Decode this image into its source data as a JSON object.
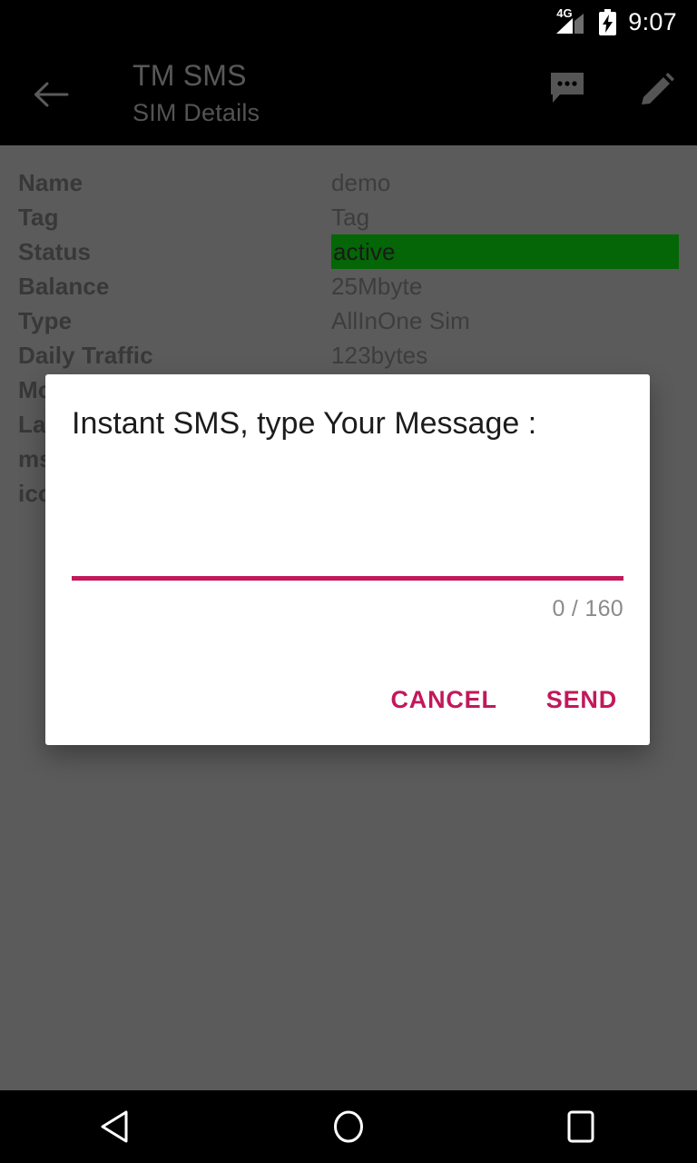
{
  "status_bar": {
    "network_label": "4G",
    "signal_icon": "signal-bars-icon",
    "battery_icon": "battery-charging-icon",
    "clock": "9:07"
  },
  "toolbar": {
    "back_icon": "back-arrow-icon",
    "title": "TM SMS",
    "subtitle": "SIM Details",
    "actions": [
      {
        "name": "messages-icon",
        "label": "Messages"
      },
      {
        "name": "edit-icon",
        "label": "Edit"
      }
    ]
  },
  "detail_list": {
    "rows": [
      {
        "label": "Name",
        "value": "demo",
        "highlight": false
      },
      {
        "label": "Tag",
        "value": "Tag",
        "highlight": false
      },
      {
        "label": "Status",
        "value": "active",
        "highlight": true
      },
      {
        "label": "Balance",
        "value": "25Mbyte",
        "highlight": false
      },
      {
        "label": "Type",
        "value": "AllInOne Sim",
        "highlight": false
      },
      {
        "label": "Daily Traffic",
        "value": "123bytes",
        "highlight": false
      },
      {
        "label": "Mo",
        "value": "",
        "highlight": false
      },
      {
        "label": "La",
        "value": "",
        "highlight": false
      },
      {
        "label": "ms",
        "value": "",
        "highlight": false
      },
      {
        "label": "ico",
        "value": "",
        "highlight": false
      }
    ]
  },
  "dialog": {
    "title": "Instant SMS, type Your Message :",
    "input_value": "",
    "input_placeholder": "",
    "char_counter": "0 / 160",
    "cancel_label": "CANCEL",
    "send_label": "SEND"
  },
  "nav_bar": {
    "back_icon": "nav-back-triangle-icon",
    "home_icon": "nav-home-circle-icon",
    "recents_icon": "nav-recents-square-icon"
  },
  "colors": {
    "accent": "#c2185b",
    "status_active": "#046606",
    "scrim": "#5b5b5b",
    "system_bar": "#000000"
  }
}
